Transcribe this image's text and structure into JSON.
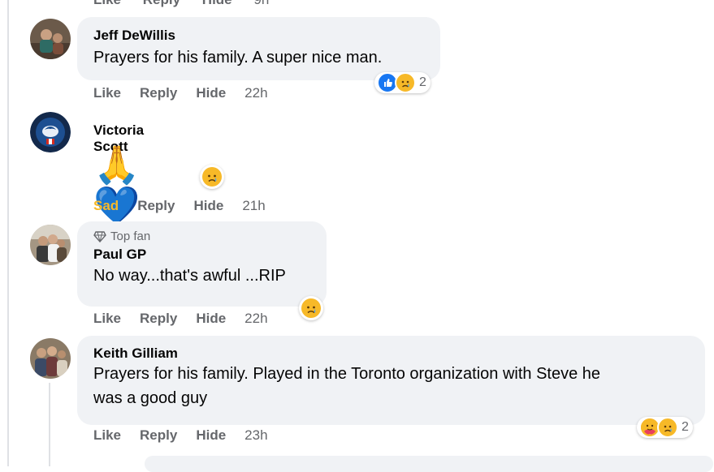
{
  "top_cut": {
    "like": "Like",
    "reply": "Reply",
    "hide": "Hide",
    "time": "9h"
  },
  "comments": [
    {
      "name": "Jeff DeWillis",
      "text": "Prayers for his family. A super nice man.",
      "actions": {
        "like": "Like",
        "reply": "Reply",
        "hide": "Hide",
        "time": "22h"
      },
      "reaction_count": "2",
      "reactions": [
        "like-icon",
        "sad-icon"
      ]
    },
    {
      "name": "Victoria Scott",
      "text": "🙏💙",
      "actions": {
        "like": "Sad",
        "reply": "Reply",
        "hide": "Hide",
        "time": "21h"
      },
      "reactions": [
        "sad-icon"
      ]
    },
    {
      "badge": "Top fan",
      "name": "Paul GP",
      "text": "No way...that's awful ...RIP",
      "actions": {
        "like": "Like",
        "reply": "Reply",
        "hide": "Hide",
        "time": "22h"
      },
      "reactions": [
        "sad-icon"
      ]
    },
    {
      "name": "Keith Gilliam",
      "text_line1": "Prayers for his family. Played in the Toronto organization with Steve he",
      "text_line2": "was a good guy",
      "actions": {
        "like": "Like",
        "reply": "Reply",
        "hide": "Hide",
        "time": "23h"
      },
      "reaction_count": "2",
      "reactions": [
        "care-icon",
        "sad-icon"
      ]
    }
  ],
  "colors": {
    "bubble": "#f0f2f5",
    "secondary_text": "#65676b",
    "sad_accent": "#f7b928",
    "like_blue": "#1877f2"
  }
}
